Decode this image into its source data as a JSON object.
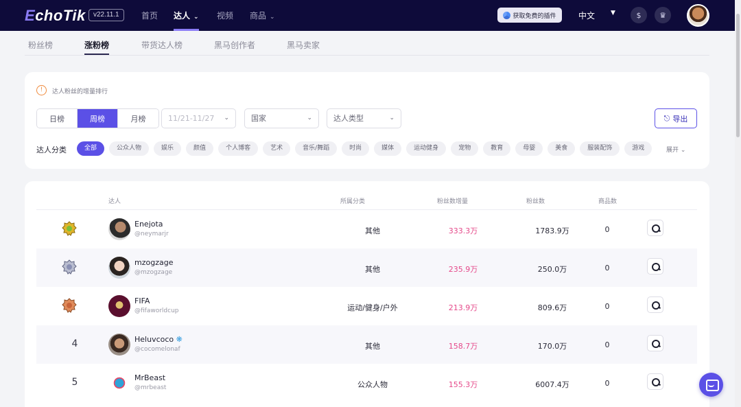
{
  "app": {
    "logo": "EchoTik",
    "version": "v22.11.1",
    "nav": [
      {
        "label": "首页"
      },
      {
        "label": "达人"
      },
      {
        "label": "视频"
      },
      {
        "label": "商品"
      }
    ],
    "plugin_button": "获取免费的插件",
    "language": "中文"
  },
  "subtabs": [
    "粉丝榜",
    "涨粉榜",
    "带货达人榜",
    "黑马创作者",
    "黑马卖家"
  ],
  "filters": {
    "info_text": "达人粉丝的增量排行",
    "periods": [
      "日榜",
      "周榜",
      "月榜"
    ],
    "active_period": "周榜",
    "date_range": "11/21-11/27",
    "country_placeholder": "国家",
    "creator_type_placeholder": "达人类型",
    "export_label": "导出",
    "category_label": "达人分类",
    "categories": [
      "全部",
      "公众人物",
      "娱乐",
      "颜值",
      "个人博客",
      "艺术",
      "音乐/舞蹈",
      "时尚",
      "媒体",
      "运动健身",
      "宠物",
      "教育",
      "母婴",
      "美食",
      "服装配饰",
      "游戏"
    ],
    "expand_label": "展开"
  },
  "table": {
    "headers": {
      "creator": "达人",
      "category": "所属分类",
      "follower_growth": "粉丝数增量",
      "followers": "粉丝数",
      "products": "商品数"
    },
    "rows": [
      {
        "rank": "1",
        "medal": "gold-medal-icon",
        "name": "Enejota",
        "handle": "@neymarjr",
        "category": "其他",
        "growth": "333.3万",
        "followers": "1783.9万",
        "products": "0"
      },
      {
        "rank": "2",
        "medal": "silver-medal-icon",
        "name": "mzogzage",
        "handle": "@mzogzage",
        "category": "其他",
        "growth": "235.9万",
        "followers": "250.0万",
        "products": "0"
      },
      {
        "rank": "3",
        "medal": "bronze-medal-icon",
        "name": "FIFA",
        "handle": "@fifaworldcup",
        "category": "运动/健身/户外",
        "growth": "213.9万",
        "followers": "809.6万",
        "products": "0"
      },
      {
        "rank": "4",
        "medal": "",
        "name": "Heluvcoco",
        "handle": "@cocomelonaf",
        "category": "其他",
        "growth": "158.7万",
        "followers": "170.0万",
        "products": "0"
      },
      {
        "rank": "5",
        "medal": "",
        "name": "MrBeast",
        "handle": "@mrbeast",
        "category": "公众人物",
        "growth": "155.3万",
        "followers": "6007.4万",
        "products": "0"
      }
    ]
  },
  "colors": {
    "nav_bg": "#0e0b3a",
    "accent": "#5b50e6",
    "growth_pink": "#e5498a"
  }
}
